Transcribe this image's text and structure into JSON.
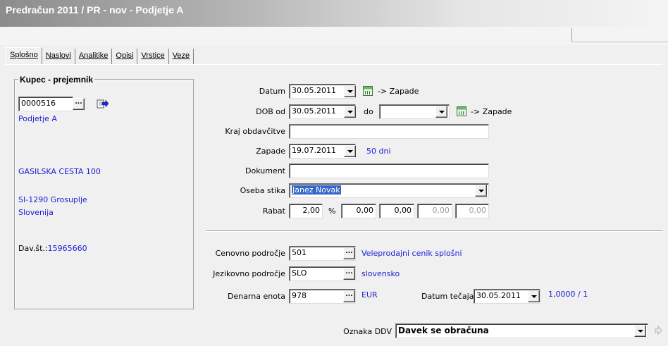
{
  "window": {
    "title": "Predračun  2011 / PR - nov - Podjetje A"
  },
  "tabs": [
    "Splošno",
    "Naslovi",
    "Analitike",
    "Opisi",
    "Vrstice",
    "Veze"
  ],
  "buyer": {
    "section_title": "Kupec - prejemnik",
    "code": "0000516",
    "name": "Podjetje A",
    "street": "GASILSKA CESTA 100",
    "postal": "SI-1290   Grosuplje",
    "country": "Slovenija",
    "tax_label": "Dav.št.:",
    "tax_number": "15965660"
  },
  "form": {
    "datum_label": "Datum",
    "datum_value": "30.05.2011",
    "datum_link": "-> Zapade",
    "dob_label": "DOB od",
    "dob_value": "30.05.2011",
    "do_label": "do",
    "do_value": "",
    "dob_link": "-> Zapade",
    "kraj_label": "Kraj obdavčitve",
    "kraj_value": "",
    "zapade_label": "Zapade",
    "zapade_value": "19.07.2011",
    "zapade_days": "50 dni",
    "dokument_label": "Dokument",
    "dokument_value": "",
    "oseba_label": "Oseba stika",
    "oseba_value": "Janez Novak",
    "rabat_label": "Rabat",
    "rabat_values": [
      "2,00",
      "0,00",
      "0,00",
      "0,00",
      "0,00"
    ],
    "rabat_percent": "%",
    "cenovno_label": "Cenovno področje",
    "cenovno_value": "501",
    "cenovno_desc": "Veleprodajni cenik splošni",
    "jezikovno_label": "Jezikovno področje",
    "jezikovno_value": "SLO",
    "jezikovno_desc": "slovensko",
    "denarna_label": "Denarna enota",
    "denarna_value": "978",
    "denarna_desc": "EUR",
    "tecaj_label": "Datum tečaja",
    "tecaj_value": "30.05.2011",
    "tecaj_rate": "1,0000 / 1",
    "ddv_label": "Oznaka DDV",
    "ddv_value": "Davek se obračuna"
  },
  "browse_button": "..."
}
